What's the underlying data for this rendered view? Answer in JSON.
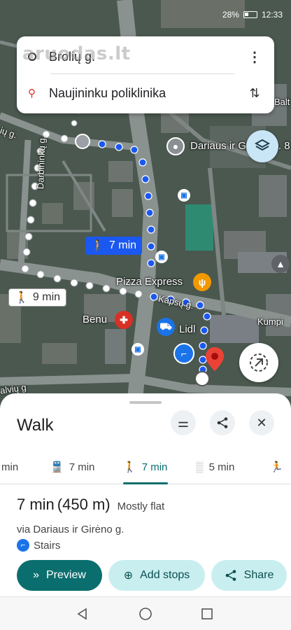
{
  "status_bar": {
    "battery": "28%",
    "time": "12:33"
  },
  "watermark": "aruodas.lt",
  "search": {
    "origin": "Brolių g.",
    "destination": "Naujininku poliklinika"
  },
  "map": {
    "street_labels": [
      "Darbininkų g.",
      "Kapsų g.",
      "Kumpi",
      "Balt",
      "alvių g",
      "ių g."
    ],
    "places": [
      "Dariaus ir Girėno g. 8",
      "Pizza Express",
      "Benu",
      "Lidl"
    ],
    "route_chips": [
      {
        "mode": "walk-icon",
        "label": "7 min",
        "selected": true
      },
      {
        "mode": "walk-icon",
        "label": "9 min",
        "selected": false
      }
    ],
    "accent_color": "#1a58f0",
    "destination_color": "#ea4335"
  },
  "sheet": {
    "title": "Walk",
    "tabs": [
      {
        "icon": "",
        "label": "min"
      },
      {
        "icon": "transit-icon",
        "label": "7 min"
      },
      {
        "icon": "walk-icon",
        "label": "7 min",
        "active": true
      },
      {
        "icon": "bike-icon",
        "label": "5 min"
      },
      {
        "icon": "ride-icon",
        "label": ""
      }
    ],
    "summary": {
      "duration": "7 min",
      "distance": "(450 m)",
      "terrain": "Mostly flat",
      "via": "via Dariaus ir Girėno g.",
      "feature": "Stairs"
    },
    "actions": {
      "preview": "Preview",
      "add_stops": "Add stops",
      "share": "Share"
    },
    "accent_color": "#0b6e6e"
  }
}
